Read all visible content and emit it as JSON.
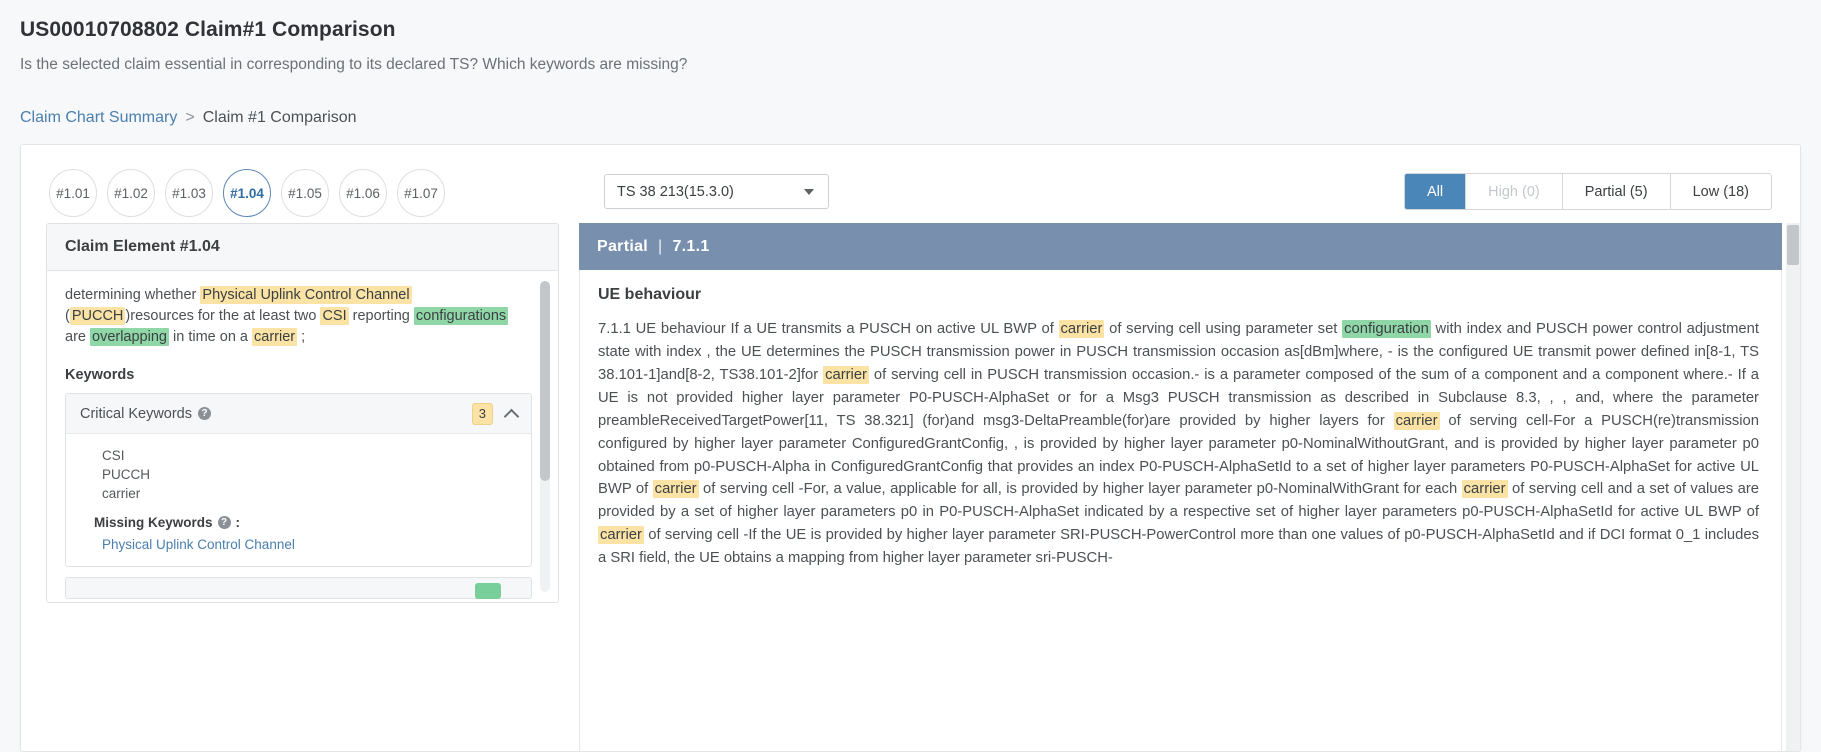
{
  "header": {
    "title": "US00010708802 Claim#1 Comparison",
    "subtitle": "Is the selected claim essential in corresponding to its declared TS? Which keywords are missing?"
  },
  "breadcrumb": {
    "link": "Claim Chart Summary",
    "separator": ">",
    "current": "Claim #1 Comparison"
  },
  "toolbar": {
    "element_pills": [
      "#1.01",
      "#1.02",
      "#1.03",
      "#1.04",
      "#1.05",
      "#1.06",
      "#1.07"
    ],
    "active_pill": "#1.04",
    "ts_select": {
      "value": "TS 38 213(15.3.0)",
      "caret_icon": "chevron-down-icon"
    },
    "filters": [
      {
        "label": "All",
        "state": "active"
      },
      {
        "label": "High (0)",
        "state": "disabled"
      },
      {
        "label": "Partial (5)",
        "state": "normal"
      },
      {
        "label": "Low (18)",
        "state": "normal"
      }
    ]
  },
  "claim_panel": {
    "title": "Claim Element #1.04",
    "text_segments": [
      {
        "t": "determining whether ",
        "h": "none"
      },
      {
        "t": "Physical Uplink Control Channel",
        "h": "yellow"
      },
      {
        "t": " (",
        "h": "none"
      },
      {
        "t": "PUCCH",
        "h": "yellow"
      },
      {
        "t": ")resources for the at least two ",
        "h": "none"
      },
      {
        "t": "CSI",
        "h": "yellow"
      },
      {
        "t": " reporting ",
        "h": "none"
      },
      {
        "t": "configurations",
        "h": "green"
      },
      {
        "t": " are ",
        "h": "none"
      },
      {
        "t": "overlapping",
        "h": "green"
      },
      {
        "t": " in time on a ",
        "h": "none"
      },
      {
        "t": "carrier",
        "h": "yellow"
      },
      {
        "t": " ;",
        "h": "none"
      }
    ],
    "keywords_heading": "Keywords",
    "critical": {
      "label": "Critical Keywords",
      "help_icon": "help-circle-icon",
      "count": "3",
      "chevron_icon": "chevron-up-icon",
      "items": [
        "CSI",
        "PUCCH",
        "carrier"
      ],
      "missing_label": "Missing Keywords",
      "missing_help_icon": "help-circle-icon",
      "missing_colon": ":",
      "missing_items": [
        "Physical Uplink Control Channel"
      ]
    }
  },
  "ts_panel": {
    "badge": "Partial",
    "separator": "|",
    "section": "7.1.1",
    "heading": "UE behaviour",
    "paragraph_segments": [
      {
        "t": "7.1.1 UE behaviour If a UE transmits a PUSCH on active UL BWP of ",
        "h": "none"
      },
      {
        "t": "carrier",
        "h": "yellow"
      },
      {
        "t": " of serving cell using parameter set ",
        "h": "none"
      },
      {
        "t": "configuration",
        "h": "green"
      },
      {
        "t": " with index and PUSCH power control adjustment state with index , the UE determines the PUSCH transmission power in PUSCH transmission occasion as[dBm]where, - is the configured UE transmit power defined in[8-1, TS 38.101-1]and[8-2, TS38.101-2]for ",
        "h": "none"
      },
      {
        "t": "carrier",
        "h": "yellow"
      },
      {
        "t": " of serving cell in PUSCH transmission occasion.- is a parameter composed of the sum of a component and a component where.- If a UE is not provided higher layer parameter P0-PUSCH-AlphaSet or for a Msg3 PUSCH transmission as described in Subclause 8.3, , , and, where the parameter preambleReceivedTargetPower[11, TS 38.321] (for)and msg3-DeltaPreamble(for)are provided by higher layers for ",
        "h": "none"
      },
      {
        "t": "carrier",
        "h": "yellow"
      },
      {
        "t": " of serving cell-For a PUSCH(re)transmission configured by higher layer parameter ConfiguredGrantConfig, , is provided by higher layer parameter p0-NominalWithoutGrant, and is provided by higher layer parameter p0 obtained from p0-PUSCH-Alpha in ConfiguredGrantConfig that provides an index P0-PUSCH-AlphaSetId to a set of higher layer parameters P0-PUSCH-AlphaSet for active UL BWP of ",
        "h": "none"
      },
      {
        "t": "carrier",
        "h": "yellow"
      },
      {
        "t": " of serving cell -For, a value, applicable for all, is provided by higher layer parameter p0-NominalWithGrant for each ",
        "h": "none"
      },
      {
        "t": "carrier",
        "h": "yellow"
      },
      {
        "t": " of serving cell and a set of values are provided by a set of higher layer parameters p0 in P0-PUSCH-AlphaSet indicated by a respective set of higher layer parameters p0-PUSCH-AlphaSetId for active UL BWP of ",
        "h": "none"
      },
      {
        "t": "carrier",
        "h": "yellow"
      },
      {
        "t": " of serving cell -If the UE is provided by higher layer parameter SRI-PUSCH-PowerControl more than one values of p0-PUSCH-AlphaSetId and if DCI format 0_1 includes a SRI field, the UE obtains a mapping from higher layer parameter sri-PUSCH-",
        "h": "none"
      }
    ]
  },
  "colors": {
    "accent_blue": "#4a86b8",
    "panel_header_blue": "#7890ae",
    "highlight_yellow": "#fae3a4",
    "highlight_green": "#8fd7a7",
    "link_blue": "#4a7fae"
  }
}
